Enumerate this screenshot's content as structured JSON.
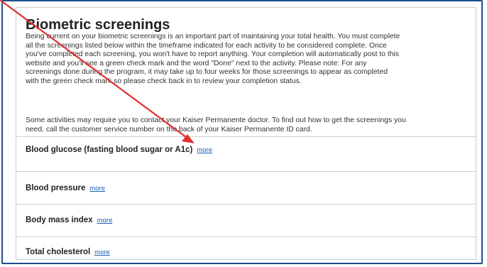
{
  "section": {
    "title": "Biometric screenings",
    "intro_paragraph": "Being current on your biometric screenings is an important part of maintaining your total health. You must complete all the screenings listed below within the timeframe indicated for each activity to be considered complete. Once you've completed each screening, you won't have to report anything. Your completion will automatically post to this website and you'll see a green check mark and the word \"Done\" next to the activity. Please note: For any screenings done during the program, it may take up to four weeks for those screenings to appear as completed with the green check mark so please check back in to review your completion status.",
    "contact_paragraph": "Some activities may require you to contact your Kaiser Permanente doctor. To find out how to get the screenings you need, call the customer service number on the back of your Kaiser Permanente ID card."
  },
  "screenings": [
    {
      "label": "Blood glucose (fasting blood sugar or A1c)",
      "more_label": "more"
    },
    {
      "label": "Blood pressure",
      "more_label": "more"
    },
    {
      "label": "Body mass index",
      "more_label": "more"
    },
    {
      "label": "Total cholesterol",
      "more_label": "more"
    }
  ],
  "colors": {
    "frame_border": "#1f4e8c",
    "link": "#1a5fb4",
    "annotation_arrow": "#e03131"
  }
}
